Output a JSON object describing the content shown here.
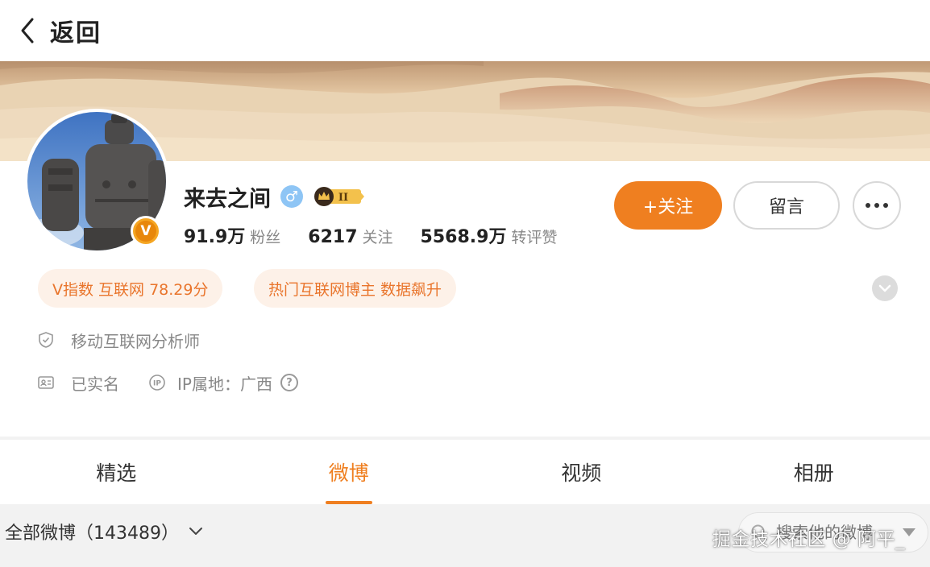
{
  "nav": {
    "back_label": "返回"
  },
  "profile": {
    "name": "来去之间",
    "gender_symbol": "♂",
    "level_badge": "II",
    "verified_badge": "V",
    "stats": [
      {
        "num": "91.9万",
        "label": "粉丝"
      },
      {
        "num": "6217",
        "label": "关注"
      },
      {
        "num": "5568.9万",
        "label": "转评赞"
      }
    ],
    "follow_label": "+关注",
    "message_label": "留言",
    "tags": [
      "V指数 互联网 78.29分",
      "热门互联网博主 数据飙升"
    ],
    "description": "移动互联网分析师",
    "verified_text": "已实名",
    "ip_location": "IP属地：广西",
    "ip_help": "?"
  },
  "tabs": [
    {
      "label": "精选",
      "active": false
    },
    {
      "label": "微博",
      "active": true
    },
    {
      "label": "视频",
      "active": false
    },
    {
      "label": "相册",
      "active": false
    }
  ],
  "filter": {
    "label": "全部微博（143489）",
    "search_placeholder": "搜索他的微博"
  },
  "watermark": "掘金技术社区 @ 阿平_",
  "colors": {
    "accent": "#ef7f20",
    "tag_bg": "#fdf1e8",
    "tag_text": "#e9752c"
  },
  "icons": {
    "back": "chevron-left-icon",
    "more": "more-dots-icon",
    "expand": "chevron-down-icon",
    "description": "shield-icon",
    "verified": "id-card-icon",
    "ip": "ip-icon",
    "search": "search-icon"
  }
}
